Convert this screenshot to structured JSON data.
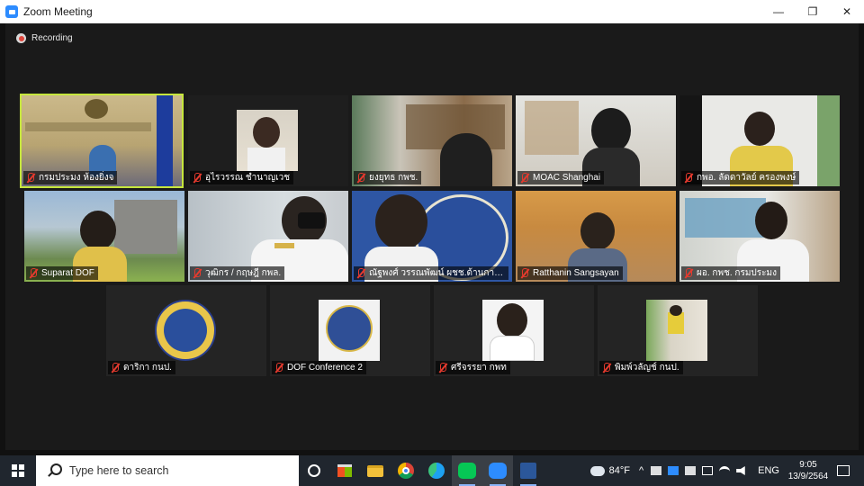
{
  "window": {
    "title": "Zoom Meeting",
    "controls": [
      "—",
      "❐",
      "✕"
    ]
  },
  "recording": {
    "label": "Recording"
  },
  "participants": [
    {
      "name": "กรมประมง ห้องยิ่งจ",
      "muted": true,
      "active": true
    },
    {
      "name": "อุไรวรรณ ชำนาญเวช",
      "muted": true
    },
    {
      "name": "ยงยุทธ กพช.",
      "muted": true
    },
    {
      "name": "MOAC Shanghai",
      "muted": true
    },
    {
      "name": "กพอ. ลัดดาวัลย์ ครองพงษ์",
      "muted": true
    },
    {
      "name": "Suparat DOF",
      "muted": true
    },
    {
      "name": "วุฒิกร / กฤษฎี กพล.",
      "muted": true
    },
    {
      "name": "ณัฐพงศ์ วรรณพัฒน์ ผชช.ด้านการเพาะ...",
      "muted": true
    },
    {
      "name": "Ratthanin Sangsayan",
      "muted": true
    },
    {
      "name": "ผอ. กพช. กรมประมง",
      "muted": true
    },
    {
      "name": "ดาริกา กนป.",
      "muted": true
    },
    {
      "name": "DOF Conference 2",
      "muted": true
    },
    {
      "name": "ศรีจรรยา กพท",
      "muted": true
    },
    {
      "name": "พิมพ์วลัญช์ กนป.",
      "muted": true
    }
  ],
  "taskbar": {
    "search_placeholder": "Type here to search",
    "weather": "84°F",
    "language": "ENG",
    "time": "9:05",
    "date": "13/9/2564"
  },
  "colors": {
    "active_speaker": "#c6e63d",
    "muted_icon": "#e63a2e",
    "zoom_blue": "#2d8cff"
  }
}
